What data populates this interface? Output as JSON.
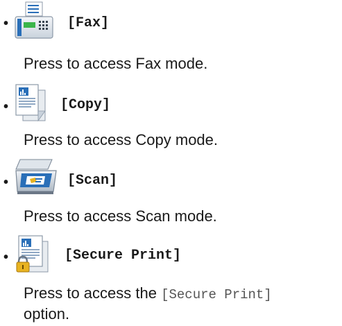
{
  "items": [
    {
      "label": "[Fax]",
      "icon": "fax-icon",
      "description": "Press to access Fax mode."
    },
    {
      "label": "[Copy]",
      "icon": "copy-icon",
      "description": "Press to access Copy mode."
    },
    {
      "label": "[Scan]",
      "icon": "scan-icon",
      "description": "Press to access Scan mode."
    },
    {
      "label": "[Secure Print]",
      "icon": "secure-print-icon",
      "description_before": "Press to access the ",
      "description_code": "[Secure Print]",
      "description_after": " option."
    }
  ],
  "bullet": "•",
  "colors": {
    "text": "#1a1a1a",
    "mono_text": "#555555",
    "icon_blue": "#2a6fb8",
    "icon_green": "#3bb54a",
    "lock_yellow": "#e8b321"
  }
}
